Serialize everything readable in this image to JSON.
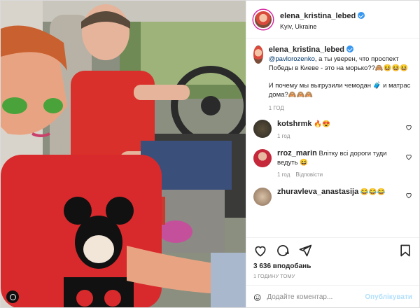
{
  "post": {
    "username": "elena_kristina_lebed",
    "location": "Kyiv, Ukraine"
  },
  "caption": {
    "username": "elena_kristina_lebed",
    "mention": "@pavlorozenko",
    "text_1": ", а ты уверен, что проспект Победы в Киеве - это на морько??🙈😆😆😆",
    "text_2": "И почему мы выгрузили чемодан 🧳 и матрас дома?🙈🙈🙈",
    "time": "1 год"
  },
  "comments": [
    {
      "username": "kotshrmk",
      "text": "🔥😍",
      "time": "1 год",
      "reply": ""
    },
    {
      "username": "rroz_marin",
      "text": "Влітку всі дороги туди ведуть 😆",
      "time": "1 год",
      "reply": "Відповісти"
    },
    {
      "username": "zhuravleva_anastasija",
      "text": "😂😂😂",
      "time": "",
      "reply": ""
    }
  ],
  "comment_meta": {
    "reply_label": "Відповісти"
  },
  "likes": "3 636 вподобань",
  "post_time": "1 годину тому",
  "add_comment": {
    "placeholder": "Додайте коментар...",
    "button": "Опублікувати"
  },
  "colors": {
    "link": "#00376b",
    "verified": "#3897f0",
    "publish": "#b2dffc"
  },
  "icons": [
    "heart-icon",
    "comment-icon",
    "share-icon",
    "bookmark-icon",
    "emoji-icon",
    "more-icon",
    "verified-icon"
  ]
}
